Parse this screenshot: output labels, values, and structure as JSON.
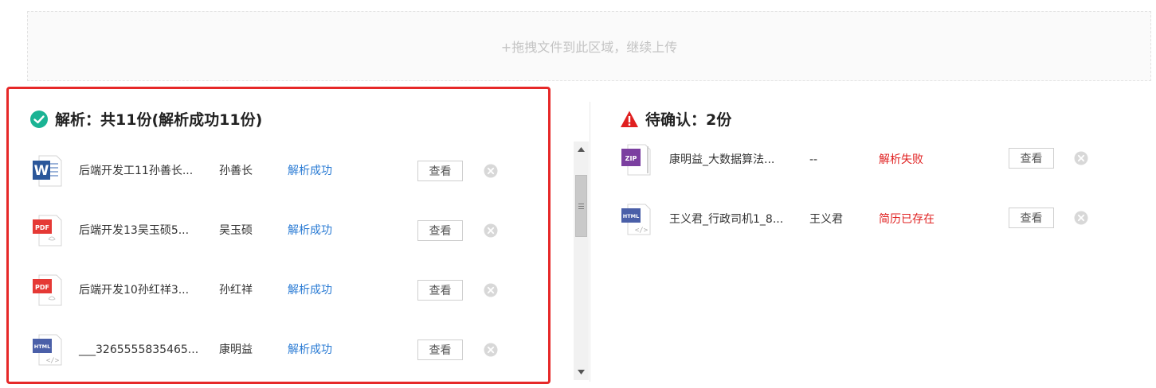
{
  "upload": {
    "drop_text": "+拖拽文件到此区域，继续上传"
  },
  "success_section": {
    "title": "解析：共11份(解析成功11份)",
    "icon": "check-circle-icon",
    "accent": "#1ab394",
    "items": [
      {
        "type": "WORD",
        "file_name": "后端开发工11孙善长...",
        "person": "孙善长",
        "status": "解析成功",
        "view": "查看"
      },
      {
        "type": "PDF",
        "file_name": "后端开发13吴玉硕5...",
        "person": "吴玉硕",
        "status": "解析成功",
        "view": "查看"
      },
      {
        "type": "PDF",
        "file_name": "后端开发10孙红祥3...",
        "person": "孙红祥",
        "status": "解析成功",
        "view": "查看"
      },
      {
        "type": "HTML",
        "file_name": "___3265555835465...",
        "person": "康明益",
        "status": "解析成功",
        "view": "查看"
      }
    ]
  },
  "pending_section": {
    "title": "待确认：2份",
    "icon": "warning-triangle-icon",
    "accent": "#e02020",
    "items": [
      {
        "type": "ZIP",
        "file_name": "康明益_大数据算法...",
        "person": "--",
        "status": "解析失败",
        "view": "查看"
      },
      {
        "type": "HTML",
        "file_name": "王义君_行政司机1_8...",
        "person": "王义君",
        "status": "简历已存在",
        "view": "查看"
      }
    ]
  },
  "colors": {
    "panel_border": "#e62828",
    "status_success": "#2a7bd4",
    "status_error": "#e02020",
    "pdf": "#e53935",
    "word": "#2b579a",
    "html": "#4a5fa8",
    "zip": "#7b3fa0"
  }
}
